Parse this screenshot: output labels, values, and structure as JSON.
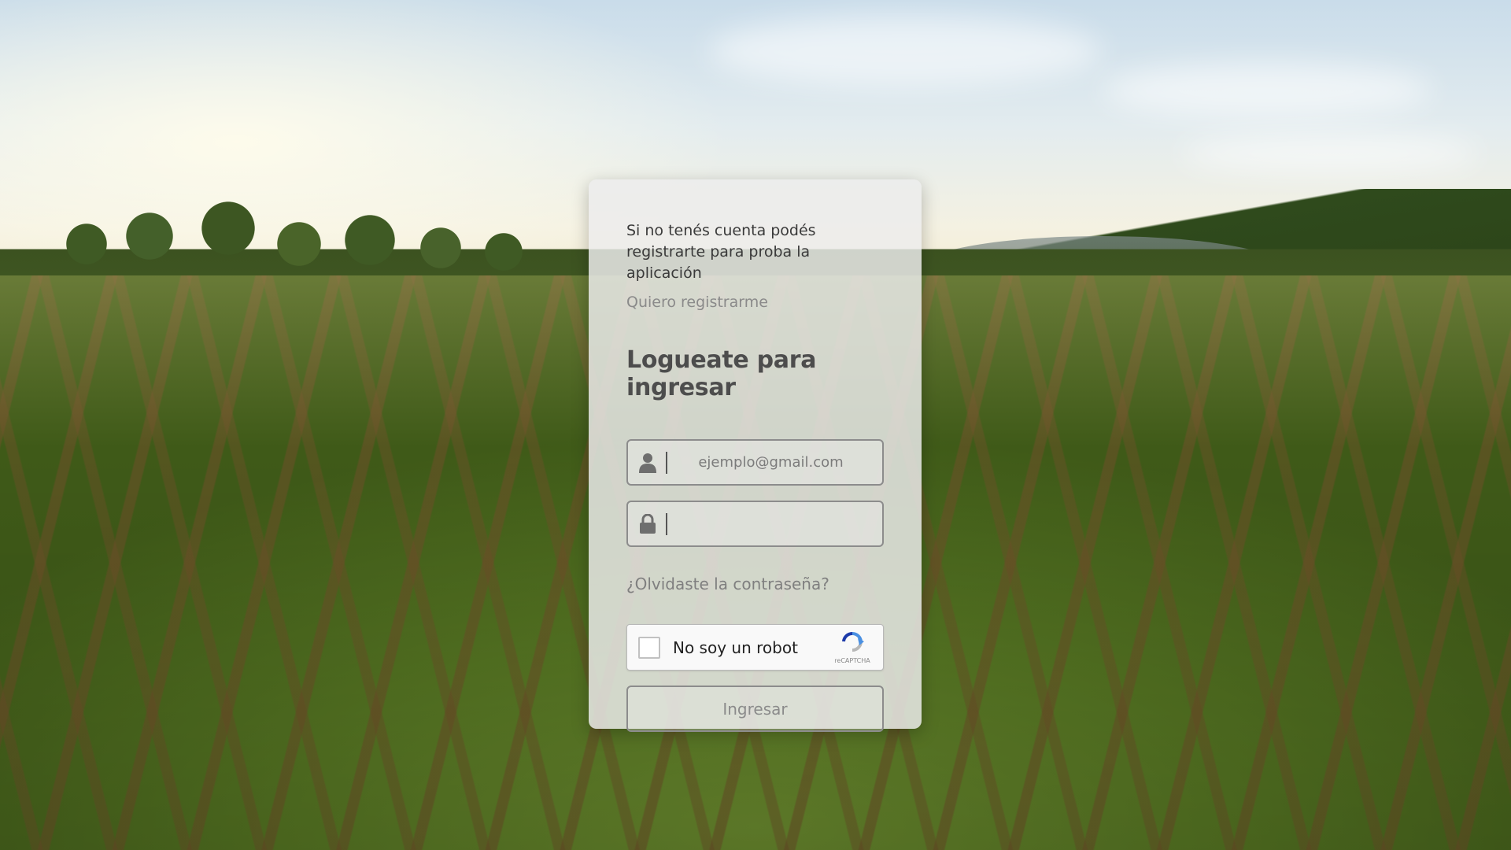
{
  "intro_text": "Si no tenés cuenta podés registrarte para proba la aplicación",
  "register_link": "Quiero registrarme",
  "title": "Logueate para ingresar",
  "email": {
    "placeholder": "ejemplo@gmail.com",
    "value": "",
    "icon": "user-icon"
  },
  "password": {
    "placeholder": "",
    "value": "",
    "icon": "lock-icon"
  },
  "forgot_link": "¿Olvidaste la contraseña?",
  "captcha": {
    "label": "No soy un robot",
    "brand": "reCAPTCHA",
    "checked": false
  },
  "submit_label": "Ingresar",
  "colors": {
    "card_bg": "#ececec",
    "text_dark": "#3a3a3a",
    "text_muted": "#8a8a8a",
    "border": "#8c8c8c",
    "captcha_blue": "#4a90e2"
  }
}
